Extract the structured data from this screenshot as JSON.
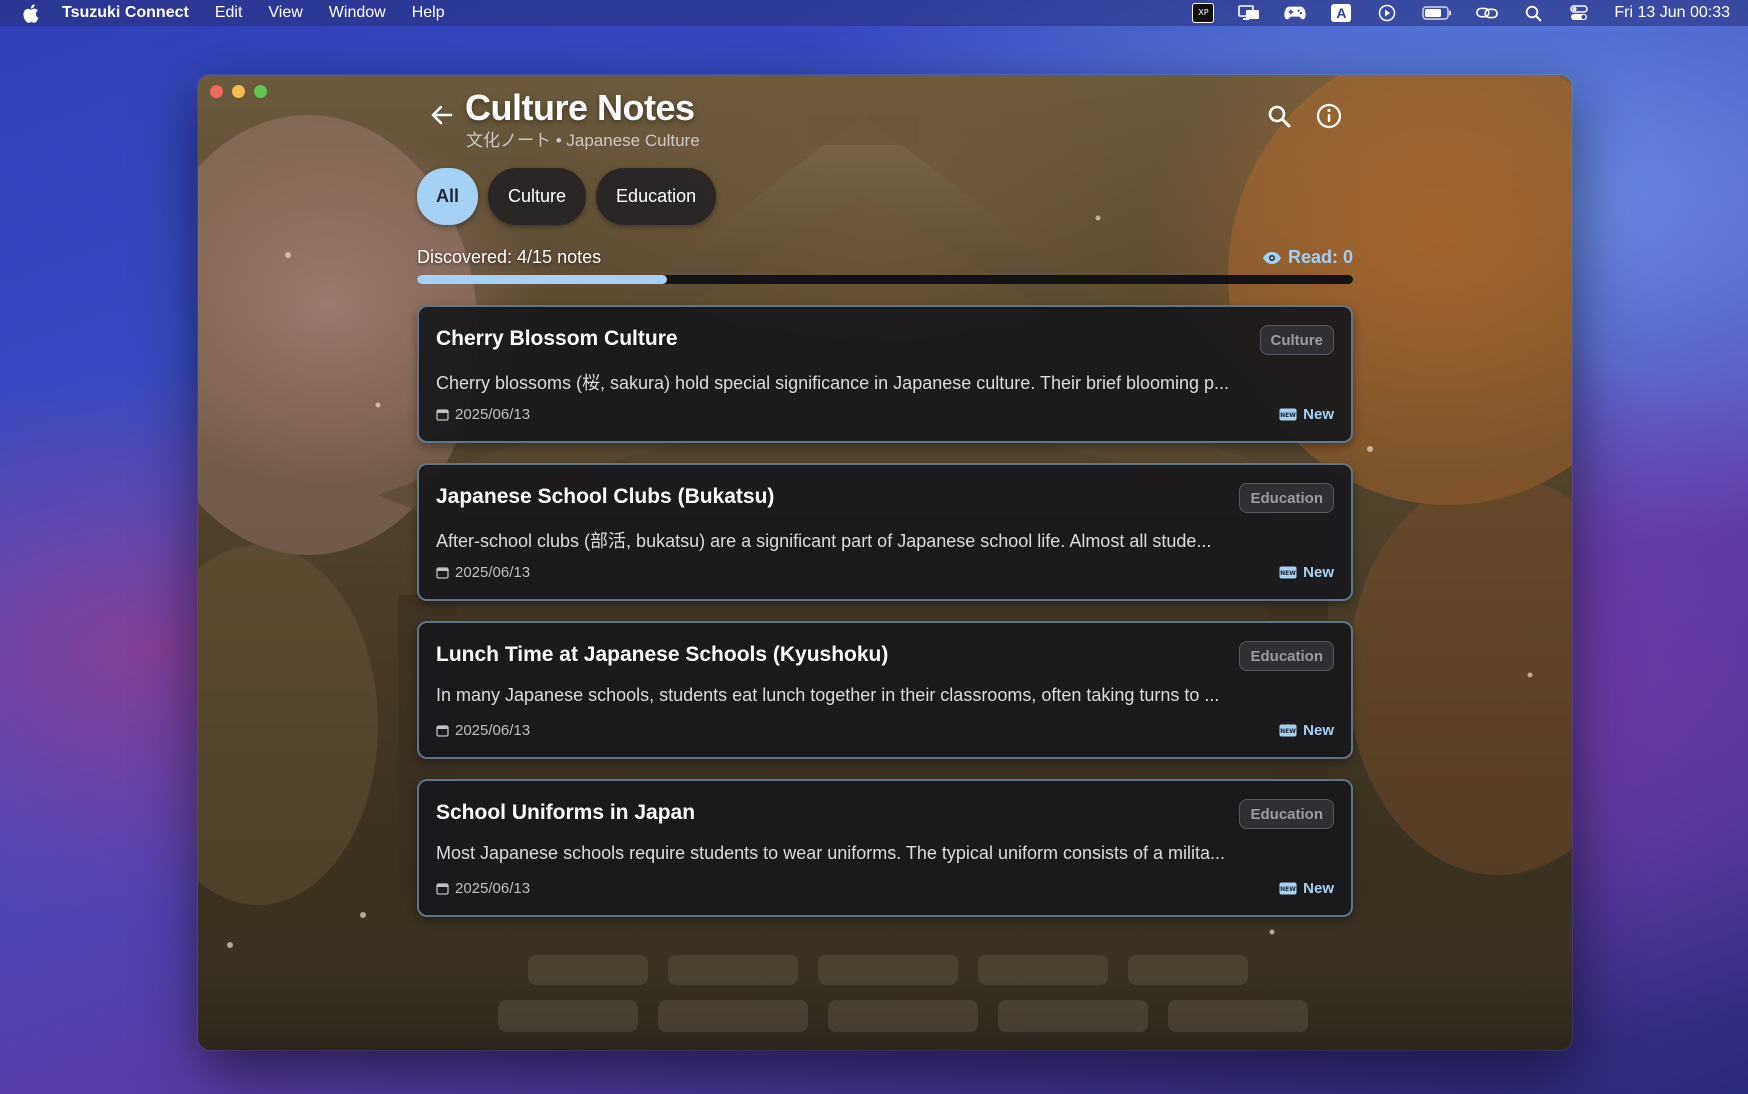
{
  "menubar": {
    "app_name": "Tsuzuki Connect",
    "menus": [
      "Edit",
      "View",
      "Window",
      "Help"
    ],
    "tray_icons": [
      "xp-pen-icon",
      "display-icon",
      "gamepad-icon",
      "input-source-a-icon",
      "play-circle-icon",
      "battery-icon",
      "link-icon",
      "spotlight-search-icon",
      "control-center-icon"
    ],
    "input_source_label": "A",
    "xppen_label": "XP",
    "clock": "Fri 13 Jun  00:33"
  },
  "window": {
    "title": "Culture Notes",
    "subtitle": "文化ノート • Japanese Culture",
    "tabs": [
      {
        "label": "All",
        "active": true
      },
      {
        "label": "Culture",
        "active": false
      },
      {
        "label": "Education",
        "active": false
      }
    ],
    "discovered_text": "Discovered: 4/15 notes",
    "progress_fraction": 0.2667,
    "read_text": "Read: 0",
    "accent_color": "#a5d2f4",
    "notes": [
      {
        "title": "Cherry Blossom Culture",
        "tag": "Culture",
        "excerpt": "Cherry blossoms (桜, sakura) hold special significance in Japanese culture. Their brief blooming p...",
        "date": "2025/06/13",
        "status": "New"
      },
      {
        "title": "Japanese School Clubs (Bukatsu)",
        "tag": "Education",
        "excerpt": "After-school clubs (部活, bukatsu) are a significant part of Japanese school life. Almost all stude...",
        "date": "2025/06/13",
        "status": "New"
      },
      {
        "title": "Lunch Time at Japanese Schools (Kyushoku)",
        "tag": "Education",
        "excerpt": "In many Japanese schools, students eat lunch together in their classrooms, often taking turns to ...",
        "date": "2025/06/13",
        "status": "New"
      },
      {
        "title": "School Uniforms in Japan",
        "tag": "Education",
        "excerpt": "Most Japanese schools require students to wear uniforms. The typical uniform consists of a milita...",
        "date": "2025/06/13",
        "status": "New"
      }
    ]
  }
}
